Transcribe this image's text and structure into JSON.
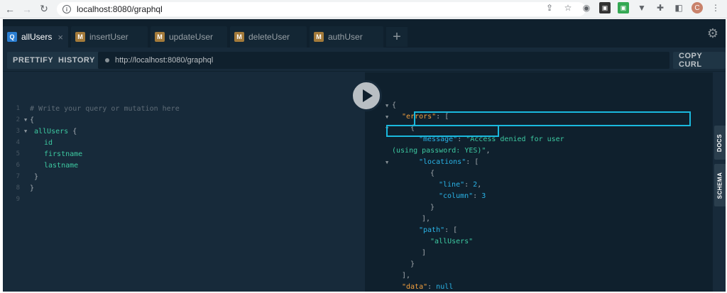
{
  "browser": {
    "url": "localhost:8080/graphql",
    "avatar_letter": "C"
  },
  "tabs": [
    {
      "badge": "Q",
      "label": "allUsers",
      "close": "×"
    },
    {
      "badge": "M",
      "label": "insertUser"
    },
    {
      "badge": "M",
      "label": "updateUser"
    },
    {
      "badge": "M",
      "label": "deleteUser"
    },
    {
      "badge": "M",
      "label": "authUser"
    }
  ],
  "add_tab": "+",
  "toolbar": {
    "prettify": "PRETTIFY",
    "history": "HISTORY",
    "endpoint": "http://localhost:8080/graphql",
    "copy_curl": "COPY CURL"
  },
  "editor": {
    "line_numbers": [
      "1",
      "2",
      "3",
      "4",
      "5",
      "6",
      "7",
      "8",
      "9"
    ],
    "comment": "# Write your query or mutation here",
    "open_brace": "{",
    "query": "allUsers",
    "query_brace": "{",
    "fields": [
      "id",
      "firstname",
      "lastname"
    ],
    "close_inner": "}",
    "close_outer": "}"
  },
  "result": {
    "open": "{",
    "errors_key": "\"errors\"",
    "message_key": "\"message\"",
    "message_value_1": "\"Access denied for user",
    "message_value_2": "(using password: YES)\"",
    "locations_key": "\"locations\"",
    "line_key": "\"line\"",
    "line_value": "2",
    "column_key": "\"column\"",
    "column_value": "3",
    "path_key": "\"path\"",
    "path_value": "\"allUsers\"",
    "data_key": "\"data\"",
    "data_value": "null"
  },
  "side_tabs": {
    "docs": "DOCS",
    "schema": "SCHEMA"
  },
  "colors": {
    "highlight": "#1ab9de",
    "background": "#172a3a",
    "result_background": "#0f202d"
  }
}
